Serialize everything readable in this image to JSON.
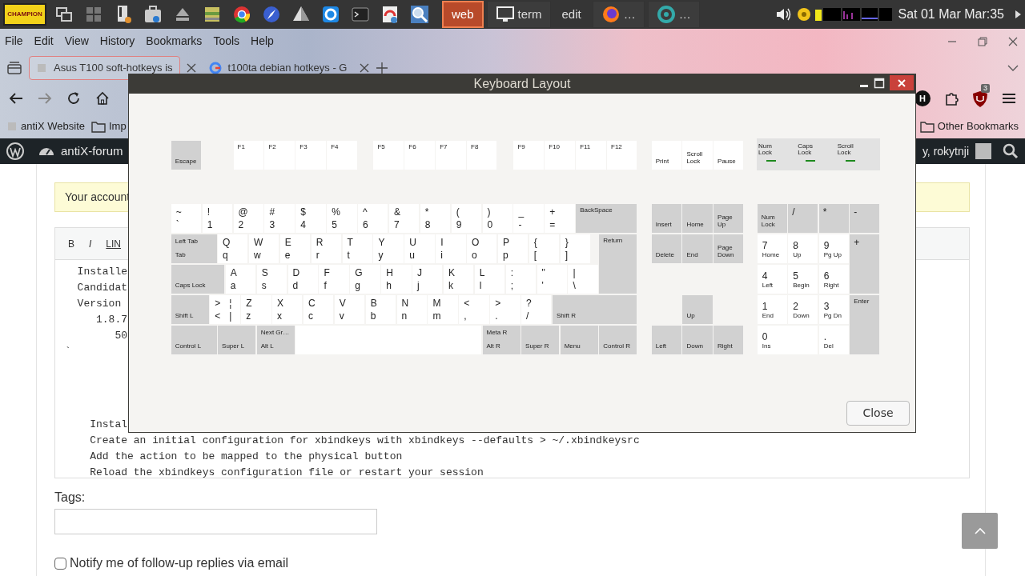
{
  "taskbar": {
    "logo": "CHAMPION",
    "tasks": [
      {
        "label": "web",
        "selected": true
      },
      {
        "label": "term",
        "selected": false
      },
      {
        "label": "edit",
        "selected": false
      },
      {
        "label": "…",
        "selected": false
      },
      {
        "label": "…",
        "selected": false
      }
    ],
    "clock": "Sat 01 Mar Mar:35"
  },
  "browser": {
    "menu": [
      "File",
      "Edit",
      "View",
      "History",
      "Bookmarks",
      "Tools",
      "Help"
    ],
    "tabs": [
      {
        "title": "Asus T100 soft-hotkeys is",
        "selected": true
      },
      {
        "title": "t100ta debian hotkeys - G",
        "selected": false
      }
    ],
    "profile_initial": "H",
    "extension_badge": "3",
    "bookmarks_left": [
      "antiX Website",
      "Imp"
    ],
    "bookmarks_right": [
      "Other Bookmarks"
    ]
  },
  "admin_bar": {
    "site": "antiX-forum",
    "user": "y, rokytnji"
  },
  "page": {
    "notice": "Your account",
    "editor_toolbar": [
      "B",
      "I",
      "LIN"
    ],
    "editor_paragraphs": [
      [
        "  Installe",
        "  Candidat",
        "  Version",
        "     1.8.7",
        "        50",
        "`"
      ],
      [
        "    Instal",
        "    Create an initial configuration for xbindkeys with xbindkeys --defaults > ~/.xbindkeysrc",
        "    Add the action to be mapped to the physical button",
        "    Reload the xbindkeys configuration file or restart your session"
      ]
    ],
    "tags_label": "Tags:",
    "notify": {
      "label": "Notify me of follow-up replies via email",
      "checked": false
    }
  },
  "dialog": {
    "title": "Keyboard Layout",
    "function_row": [
      {
        "kind": "modifier",
        "labels": [
          "Escape"
        ]
      },
      {
        "kind": "function",
        "labels": [
          "F1"
        ]
      },
      {
        "kind": "function",
        "labels": [
          "F2"
        ]
      },
      {
        "kind": "function",
        "labels": [
          "F3"
        ]
      },
      {
        "kind": "function",
        "labels": [
          "F4"
        ]
      },
      {
        "kind": "function",
        "labels": [
          "F5"
        ]
      },
      {
        "kind": "function",
        "labels": [
          "F6"
        ]
      },
      {
        "kind": "function",
        "labels": [
          "F7"
        ]
      },
      {
        "kind": "function",
        "labels": [
          "F8"
        ]
      },
      {
        "kind": "function",
        "labels": [
          "F9"
        ]
      },
      {
        "kind": "function",
        "labels": [
          "F10"
        ]
      },
      {
        "kind": "function",
        "labels": [
          "F11"
        ]
      },
      {
        "kind": "function",
        "labels": [
          "F12"
        ]
      }
    ],
    "system_keys": [
      {
        "kind": "special",
        "labels": [
          "Print"
        ]
      },
      {
        "kind": "special",
        "labels": [
          "Scroll Lock"
        ]
      },
      {
        "kind": "special",
        "labels": [
          "Pause"
        ]
      }
    ],
    "lock_indicators": [
      {
        "label": "Num Lock"
      },
      {
        "label": "Caps Lock"
      },
      {
        "label": "Scroll Lock"
      }
    ],
    "main_keys": [
      {
        "kind": "char",
        "labels": [
          "~",
          "`"
        ]
      },
      {
        "kind": "char",
        "labels": [
          "!",
          "1"
        ]
      },
      {
        "kind": "char",
        "labels": [
          "@",
          "2"
        ]
      },
      {
        "kind": "char",
        "labels": [
          "#",
          "3"
        ]
      },
      {
        "kind": "char",
        "labels": [
          "$",
          "4"
        ]
      },
      {
        "kind": "char",
        "labels": [
          "%",
          "5"
        ]
      },
      {
        "kind": "char",
        "labels": [
          "^",
          "6"
        ]
      },
      {
        "kind": "char",
        "labels": [
          "&",
          "7"
        ]
      },
      {
        "kind": "char",
        "labels": [
          "*",
          "8"
        ]
      },
      {
        "kind": "char",
        "labels": [
          "(",
          "9"
        ]
      },
      {
        "kind": "char",
        "labels": [
          ")",
          "0"
        ]
      },
      {
        "kind": "char",
        "labels": [
          "_",
          "-"
        ]
      },
      {
        "kind": "char",
        "labels": [
          "+",
          "="
        ]
      },
      {
        "kind": "command",
        "labels": [
          "BackSpace"
        ]
      },
      {
        "kind": "modifier",
        "labels": [
          "Left Tab",
          "Tab"
        ]
      },
      {
        "kind": "char",
        "labels": [
          "Q",
          "q"
        ]
      },
      {
        "kind": "char",
        "labels": [
          "W",
          "w"
        ]
      },
      {
        "kind": "char",
        "labels": [
          "E",
          "e"
        ]
      },
      {
        "kind": "char",
        "labels": [
          "R",
          "r"
        ]
      },
      {
        "kind": "char",
        "labels": [
          "T",
          "t"
        ]
      },
      {
        "kind": "char",
        "labels": [
          "Y",
          "y"
        ]
      },
      {
        "kind": "char",
        "labels": [
          "U",
          "u"
        ]
      },
      {
        "kind": "char",
        "labels": [
          "I",
          "i"
        ]
      },
      {
        "kind": "char",
        "labels": [
          "O",
          "o"
        ]
      },
      {
        "kind": "char",
        "labels": [
          "P",
          "p"
        ]
      },
      {
        "kind": "char",
        "labels": [
          "{",
          "["
        ]
      },
      {
        "kind": "char",
        "labels": [
          "}",
          "]"
        ]
      },
      {
        "kind": "command",
        "labels": [
          "Return"
        ]
      },
      {
        "kind": "modifier",
        "labels": [
          "Caps Lock"
        ]
      },
      {
        "kind": "char",
        "labels": [
          "A",
          "a"
        ]
      },
      {
        "kind": "char",
        "labels": [
          "S",
          "s"
        ]
      },
      {
        "kind": "char",
        "labels": [
          "D",
          "d"
        ]
      },
      {
        "kind": "char",
        "labels": [
          "F",
          "f"
        ]
      },
      {
        "kind": "char",
        "labels": [
          "G",
          "g"
        ]
      },
      {
        "kind": "char",
        "labels": [
          "H",
          "h"
        ]
      },
      {
        "kind": "char",
        "labels": [
          "J",
          "j"
        ]
      },
      {
        "kind": "char",
        "labels": [
          "K",
          "k"
        ]
      },
      {
        "kind": "char",
        "labels": [
          "L",
          "l"
        ]
      },
      {
        "kind": "char",
        "labels": [
          ":",
          ";"
        ]
      },
      {
        "kind": "char",
        "labels": [
          "\"",
          "'"
        ]
      },
      {
        "kind": "char",
        "labels": [
          "|",
          "\\"
        ]
      },
      {
        "kind": "modifier",
        "labels": [
          "Shift L"
        ]
      },
      {
        "kind": "char",
        "labels": [
          ">",
          "<"
        ],
        "alt_labels": [
          "¦",
          "|"
        ]
      },
      {
        "kind": "char",
        "labels": [
          "Z",
          "z"
        ]
      },
      {
        "kind": "char",
        "labels": [
          "X",
          "x"
        ]
      },
      {
        "kind": "char",
        "labels": [
          "C",
          "c"
        ]
      },
      {
        "kind": "char",
        "labels": [
          "V",
          "v"
        ]
      },
      {
        "kind": "char",
        "labels": [
          "B",
          "b"
        ]
      },
      {
        "kind": "char",
        "labels": [
          "N",
          "n"
        ]
      },
      {
        "kind": "char",
        "labels": [
          "M",
          "m"
        ]
      },
      {
        "kind": "char",
        "labels": [
          "<",
          ","
        ]
      },
      {
        "kind": "char",
        "labels": [
          ">",
          "."
        ]
      },
      {
        "kind": "char",
        "labels": [
          "?",
          "/"
        ]
      },
      {
        "kind": "modifier",
        "labels": [
          "Shift R"
        ]
      },
      {
        "kind": "modifier",
        "labels": [
          "Control L"
        ]
      },
      {
        "kind": "modifier",
        "labels": [
          "Super L"
        ]
      },
      {
        "kind": "modifier",
        "labels": [
          "Next Gr…",
          "Alt L"
        ]
      },
      {
        "kind": "space"
      },
      {
        "kind": "modifier",
        "labels": [
          "Meta R",
          "Alt R"
        ]
      },
      {
        "kind": "modifier",
        "labels": [
          "Super R"
        ]
      },
      {
        "kind": "modifier",
        "labels": [
          "Menu"
        ]
      },
      {
        "kind": "modifier",
        "labels": [
          "Control R"
        ]
      }
    ],
    "navigation_keys": [
      {
        "kind": "modifier",
        "labels": [
          "Insert"
        ]
      },
      {
        "kind": "modifier",
        "labels": [
          "Home"
        ]
      },
      {
        "kind": "modifier",
        "labels": [
          "Page Up"
        ]
      },
      {
        "kind": "modifier",
        "labels": [
          "Delete"
        ]
      },
      {
        "kind": "modifier",
        "labels": [
          "End"
        ]
      },
      {
        "kind": "modifier",
        "labels": [
          "Page Down"
        ]
      },
      {
        "kind": "modifier",
        "labels": [
          "Up"
        ]
      },
      {
        "kind": "modifier",
        "labels": [
          "Left"
        ]
      },
      {
        "kind": "modifier",
        "labels": [
          "Down"
        ]
      },
      {
        "kind": "modifier",
        "labels": [
          "Right"
        ]
      }
    ],
    "keypad_keys": [
      {
        "kind": "modifier",
        "labels": [
          "Num Lock"
        ]
      },
      {
        "kind": "command",
        "labels": [
          "/"
        ]
      },
      {
        "kind": "command",
        "labels": [
          "*"
        ]
      },
      {
        "kind": "command",
        "labels": [
          "-"
        ]
      },
      {
        "kind": "keypad",
        "labels": [
          "7",
          "Home"
        ]
      },
      {
        "kind": "keypad",
        "labels": [
          "8",
          "Up"
        ]
      },
      {
        "kind": "keypad",
        "labels": [
          "9",
          "Pg Up"
        ]
      },
      {
        "kind": "command",
        "labels": [
          "+"
        ]
      },
      {
        "kind": "keypad",
        "labels": [
          "4",
          "Left"
        ]
      },
      {
        "kind": "keypad",
        "labels": [
          "5",
          "Begin"
        ]
      },
      {
        "kind": "keypad",
        "labels": [
          "6",
          "Right"
        ]
      },
      {
        "kind": "keypad",
        "labels": [
          "1",
          "End"
        ]
      },
      {
        "kind": "keypad",
        "labels": [
          "2",
          "Down"
        ]
      },
      {
        "kind": "keypad",
        "labels": [
          "3",
          "Pg Dn"
        ]
      },
      {
        "kind": "command",
        "labels": [
          "Enter"
        ]
      },
      {
        "kind": "keypad",
        "labels": [
          "0",
          "Ins"
        ]
      },
      {
        "kind": "keypad",
        "labels": [
          ".",
          "Del"
        ]
      }
    ],
    "close_button": "Close"
  }
}
